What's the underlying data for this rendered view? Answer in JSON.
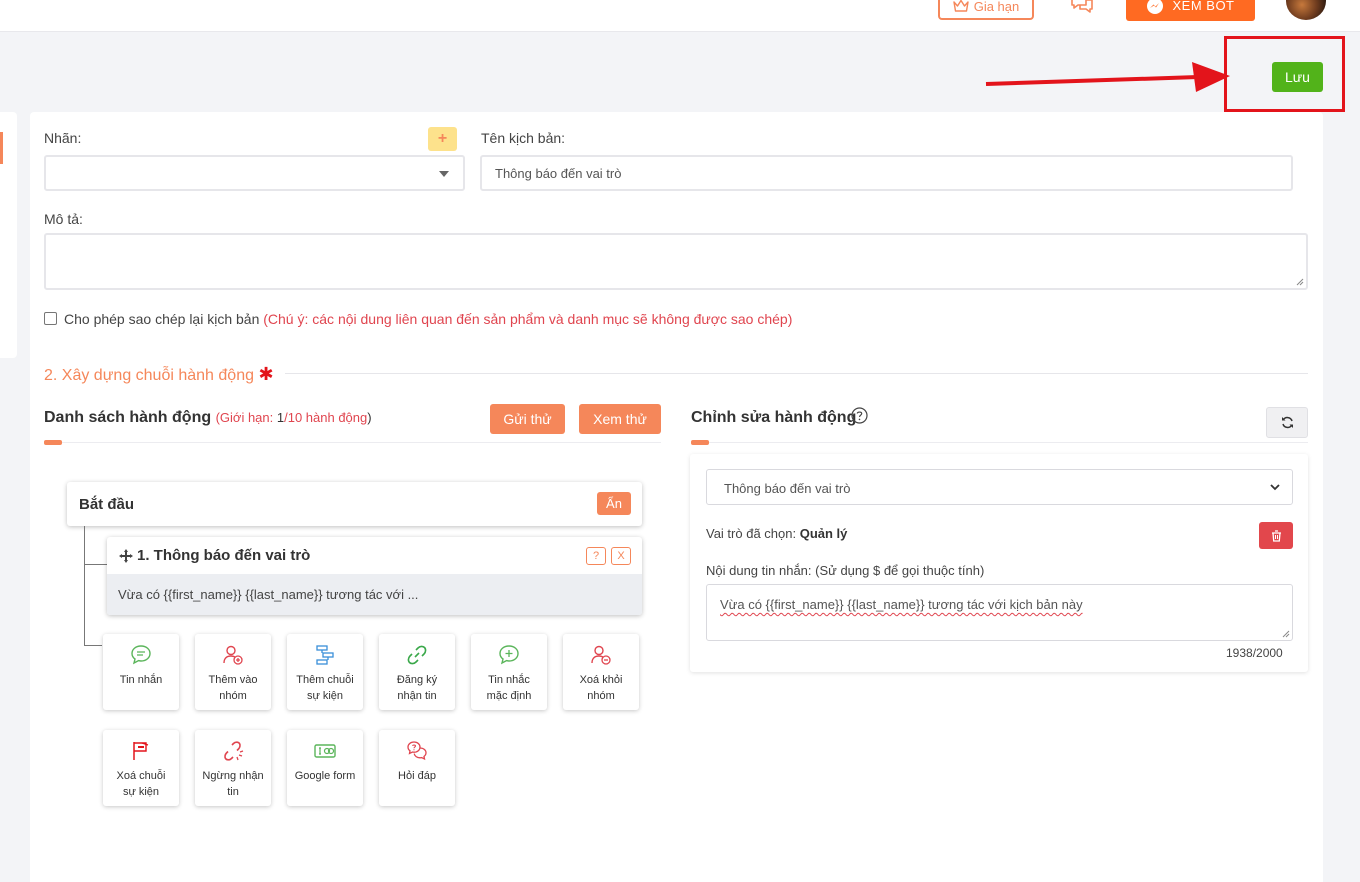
{
  "topbar": {
    "renew_label": "Gia hạn",
    "xembot_label": "XEM BOT"
  },
  "toolbar": {
    "save_label": "Lưu"
  },
  "form": {
    "label_field_label": "Nhãn:",
    "label_field_value": "",
    "add_label_symbol": "+",
    "script_name_label": "Tên kịch bản:",
    "script_name_value": "Thông báo đến vai trò",
    "description_label": "Mô tả:",
    "description_value": "",
    "allow_copy_label": "Cho phép sao chép lại kịch bản",
    "allow_copy_note": "(Chú ý: các nội dung liên quan đến sản phẩm và danh mục sẽ không được sao chép)"
  },
  "section": {
    "title": "2. Xây dựng chuỗi hành động",
    "required_mark": "✱"
  },
  "action_list": {
    "title": "Danh sách hành động",
    "limit_open": "(",
    "limit_prefix": "Giới hạn: ",
    "limit_current": "1",
    "limit_rest": "/10 hành động",
    "limit_close": ")",
    "send_test_label": "Gửi thử",
    "preview_label": "Xem thử",
    "start_label": "Bắt đầu",
    "hide_label": "Ẩn",
    "action_title": "1. Thông báo đến vai trò",
    "action_help": "?",
    "action_close": "X",
    "action_preview": "Vừa có {{first_name}} {{last_name}} tương tác với ...",
    "tiles": [
      {
        "line1": "Tin nhắn",
        "line2": ""
      },
      {
        "line1": "Thêm vào",
        "line2": "nhóm"
      },
      {
        "line1": "Thêm chuỗi",
        "line2": "sự kiện"
      },
      {
        "line1": "Đăng ký",
        "line2": "nhận tin"
      },
      {
        "line1": "Tin nhắc",
        "line2": "mặc định"
      },
      {
        "line1": "Xoá khỏi",
        "line2": "nhóm"
      },
      {
        "line1": "Xoá chuỗi",
        "line2": "sự kiện"
      },
      {
        "line1": "Ngừng nhận",
        "line2": "tin"
      },
      {
        "line1": "Google form",
        "line2": ""
      },
      {
        "line1": "Hỏi đáp",
        "line2": ""
      }
    ]
  },
  "editor": {
    "title": "Chỉnh sửa hành động",
    "action_type_value": "Thông báo đến vai trò",
    "role_prefix": "Vai trò đã chọn: ",
    "role_value": "Quản lý",
    "message_label": "Nội dung tin nhắn: (Sử dụng $ để gọi thuộc tính)",
    "message_value": "Vừa có {{first_name}} {{last_name}} tương tác với kịch bản này",
    "counter": "1938/2000"
  },
  "colors": {
    "accent": "#f5875a",
    "save_green": "#52b31a",
    "xembot_orange": "#ff6a22",
    "danger": "#e2474c",
    "annotation_red": "#e3141b"
  }
}
